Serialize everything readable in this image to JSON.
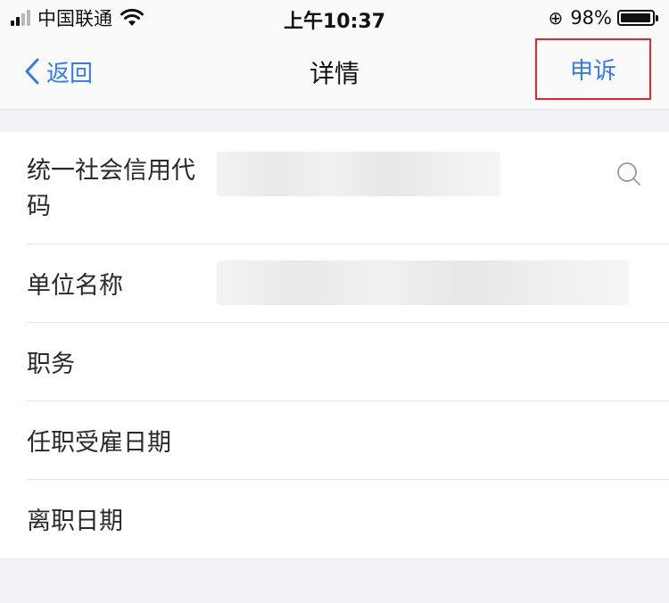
{
  "status_bar": {
    "carrier": "中国联通",
    "time": "上午10:37",
    "battery_percent": "98%",
    "battery_level": 0.98,
    "icons": [
      "signal-icon",
      "wifi-icon",
      "orientation-lock-icon",
      "battery-icon"
    ]
  },
  "nav": {
    "back_label": "返回",
    "title": "详情",
    "appeal_label": "申诉",
    "accent_color": "#3478f6",
    "highlight_color": "#e0272b"
  },
  "rows": [
    {
      "label": "统一社会信用代码",
      "value": ""
    },
    {
      "label": "单位名称",
      "value": ""
    },
    {
      "label": "职务",
      "value": ""
    },
    {
      "label": "任职受雇日期",
      "value": ""
    },
    {
      "label": "离职日期",
      "value": ""
    }
  ]
}
